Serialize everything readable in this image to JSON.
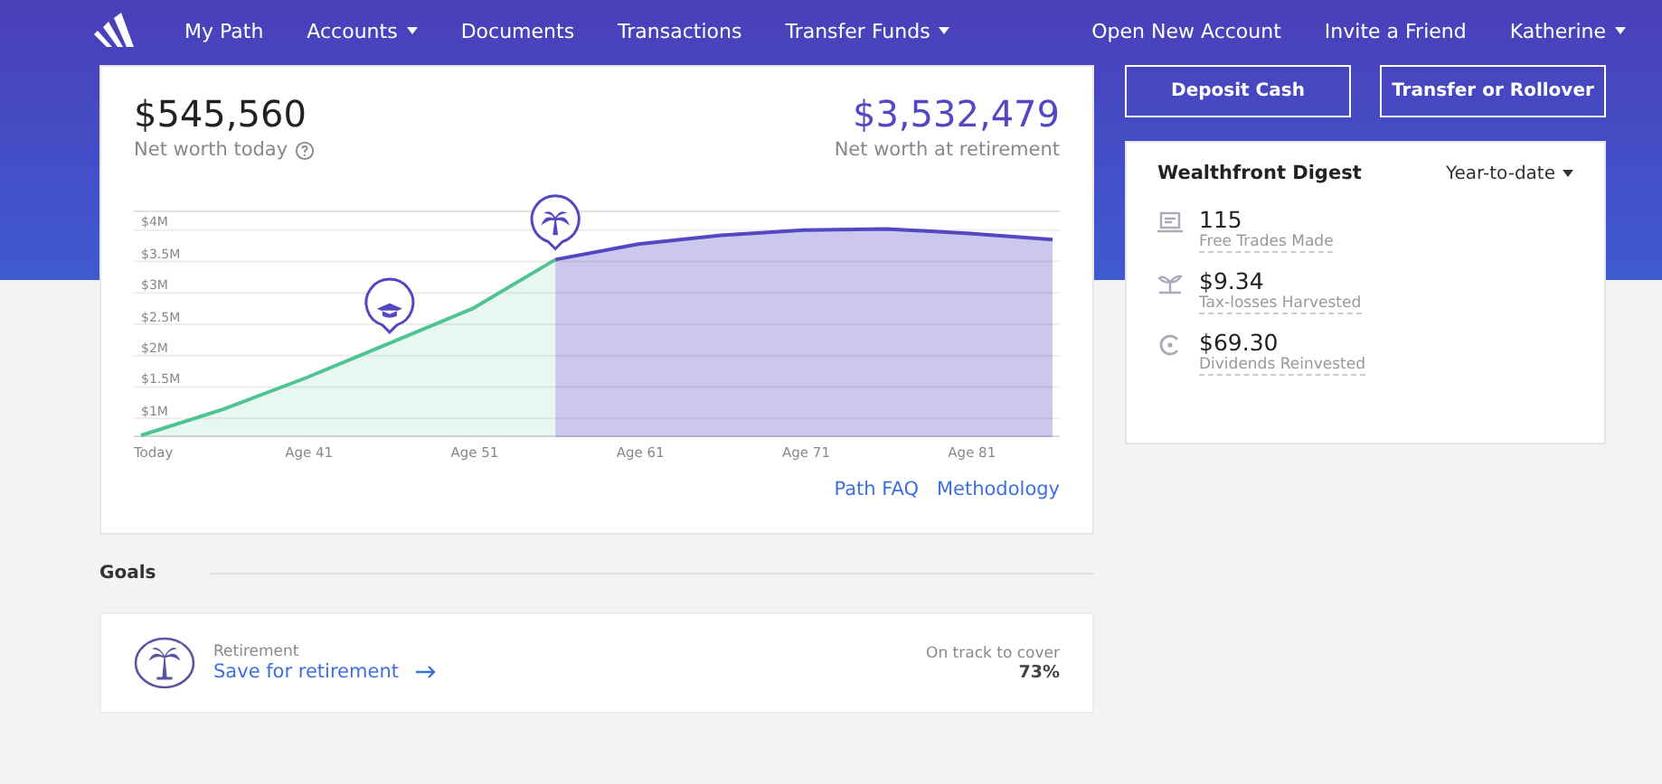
{
  "nav": {
    "left": [
      {
        "label": "My Path",
        "dropdown": false
      },
      {
        "label": "Accounts",
        "dropdown": true
      },
      {
        "label": "Documents",
        "dropdown": false
      },
      {
        "label": "Transactions",
        "dropdown": false
      },
      {
        "label": "Transfer Funds",
        "dropdown": true
      }
    ],
    "right": [
      {
        "label": "Open New Account",
        "dropdown": false
      },
      {
        "label": "Invite a Friend",
        "dropdown": false
      },
      {
        "label": "Katherine",
        "dropdown": true
      }
    ]
  },
  "summary": {
    "today_value": "$545,560",
    "today_label": "Net worth today",
    "retirement_value": "$3,532,479",
    "retirement_label": "Net worth at retirement"
  },
  "chart_data": {
    "type": "area",
    "categories": [
      "Today",
      null,
      "Age 41",
      null,
      "Age 51",
      null,
      "Age 61",
      null,
      "Age 71",
      null,
      "Age 81",
      null
    ],
    "grid": true,
    "ylim": [
      700000,
      4300000
    ],
    "yticks": [
      {
        "value": 1000000,
        "label": "$1M"
      },
      {
        "value": 1500000,
        "label": "$1.5M"
      },
      {
        "value": 2000000,
        "label": "$2M"
      },
      {
        "value": 2500000,
        "label": "$2.5M"
      },
      {
        "value": 3000000,
        "label": "$3M"
      },
      {
        "value": 3500000,
        "label": "$3.5M"
      },
      {
        "value": 4000000,
        "label": "$4M"
      }
    ],
    "series": [
      {
        "color": "#4fc493",
        "values": [
          730000,
          1150000,
          1650000,
          2200000,
          2750000,
          3530000,
          null,
          null,
          null,
          null,
          null,
          null
        ]
      },
      {
        "color": "#5347c4",
        "values": [
          null,
          null,
          null,
          null,
          null,
          3530000,
          3780000,
          3920000,
          4000000,
          4020000,
          3950000,
          3850000
        ]
      }
    ]
  },
  "chart_links": [
    "Path FAQ",
    "Methodology"
  ],
  "actions": [
    "Deposit Cash",
    "Transfer or Rollover"
  ],
  "digest": {
    "title": "Wealthfront Digest",
    "period": "Year-to-date",
    "items": [
      {
        "kind": "trades",
        "value": "115",
        "label": "Free Trades Made"
      },
      {
        "kind": "harvest",
        "value": "$9.34",
        "label": "Tax-losses Harvested"
      },
      {
        "kind": "dividends",
        "value": "$69.30",
        "label": "Dividends Reinvested"
      }
    ]
  },
  "goals": {
    "heading": "Goals",
    "items": [
      {
        "category": "Retirement",
        "link": "Save for retirement",
        "status": "On track to cover",
        "percent": "73%"
      }
    ]
  }
}
